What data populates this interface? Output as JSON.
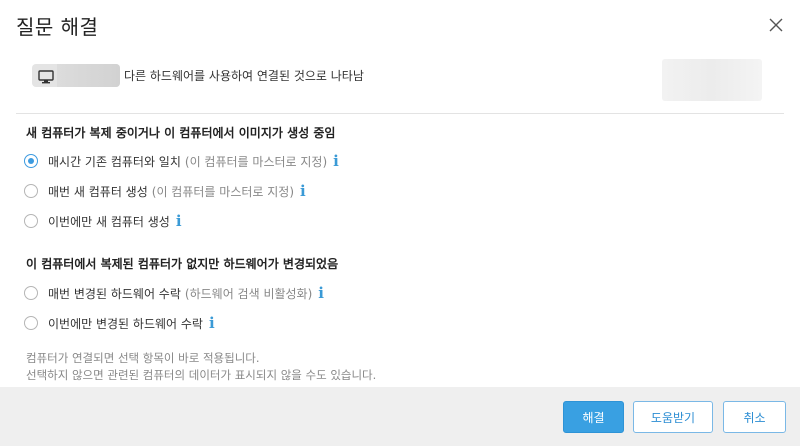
{
  "dialog": {
    "title": "질문 해결"
  },
  "device": {
    "description": "다른 하드웨어를 사용하여 연결된 것으로 나타남",
    "icon": "monitor-icon"
  },
  "section1": {
    "title": "새 컴퓨터가 복제 중이거나 이 컴퓨터에서 이미지가 생성 중임",
    "options": [
      {
        "label": "매시간 기존 컴퓨터와 일치",
        "note": "(이 컴퓨터를 마스터로 지정)",
        "selected": true
      },
      {
        "label": "매번 새 컴퓨터 생성",
        "note": "(이 컴퓨터를 마스터로 지정)",
        "selected": false
      },
      {
        "label": "이번에만 새 컴퓨터 생성",
        "note": "",
        "selected": false
      }
    ]
  },
  "section2": {
    "title": "이 컴퓨터에서 복제된 컴퓨터가 없지만 하드웨어가 변경되었음",
    "options": [
      {
        "label": "매번 변경된 하드웨어 수락",
        "note": "(하드웨어 검색 비활성화)",
        "selected": false
      },
      {
        "label": "이번에만 변경된 하드웨어 수락",
        "note": "",
        "selected": false
      }
    ]
  },
  "helper": {
    "line1": "컴퓨터가 연결되면 선택 항목이 바로 적용됩니다.",
    "line2": "선택하지 않으면 관련된 컴퓨터의 데이터가 표시되지 않을 수도 있습니다."
  },
  "info_glyph": "i",
  "buttons": {
    "resolve": "해결",
    "help": "도움받기",
    "cancel": "취소"
  },
  "colors": {
    "accent": "#39a0e2",
    "info": "#3a9ad6",
    "footer_bg": "#efefef"
  }
}
